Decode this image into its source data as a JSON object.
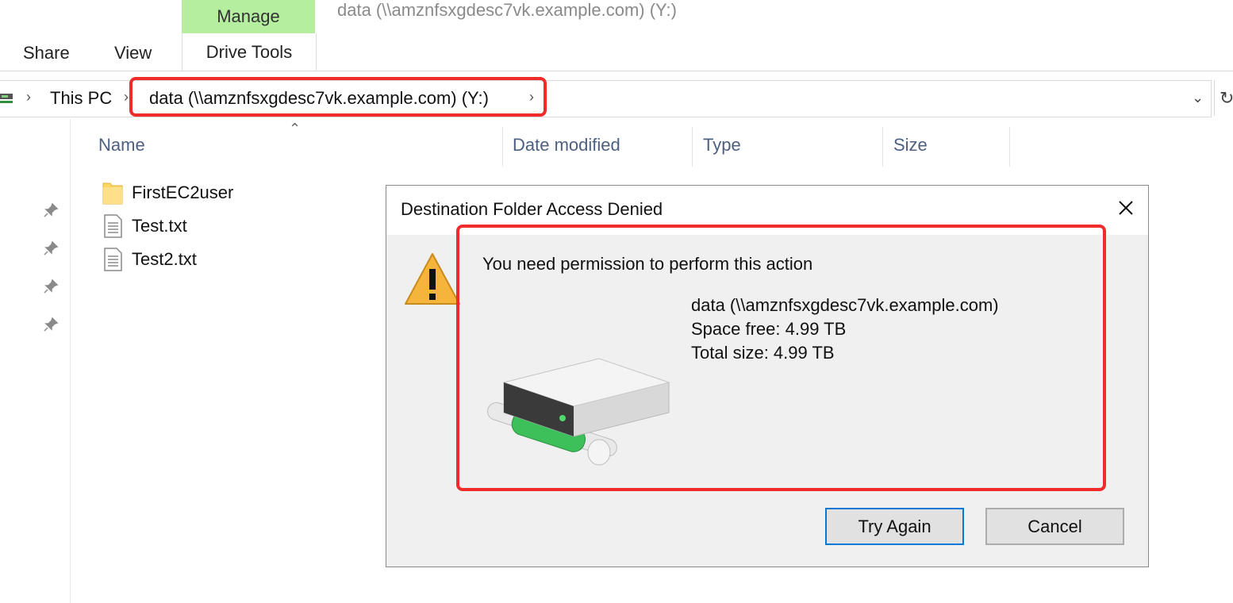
{
  "ribbon": {
    "contextual_group": "Manage",
    "window_title": "data (\\\\amznfsxgdesc7vk.example.com) (Y:)",
    "tabs": [
      "Share",
      "View",
      "Drive Tools"
    ]
  },
  "address": {
    "crumbs": [
      "This PC",
      "data (\\\\amznfsxgdesc7vk.example.com) (Y:)"
    ]
  },
  "columns": [
    "Name",
    "Date modified",
    "Type",
    "Size"
  ],
  "files": [
    {
      "name": "FirstEC2user",
      "icon": "folder-icon"
    },
    {
      "name": "Test.txt",
      "icon": "text-file-icon"
    },
    {
      "name": "Test2.txt",
      "icon": "text-file-icon"
    }
  ],
  "dialog": {
    "title": "Destination Folder Access Denied",
    "message": "You need permission to perform this action",
    "drive_name": "data (\\\\amznfsxgdesc7vk.example.com)",
    "space_free": "Space free: 4.99 TB",
    "total_size": "Total size: 4.99 TB",
    "buttons": {
      "try_again": "Try Again",
      "cancel": "Cancel"
    }
  },
  "colors": {
    "highlight": "#f02b2b",
    "manage_tab": "#b6ee9f",
    "default_button_border": "#0078d7"
  }
}
